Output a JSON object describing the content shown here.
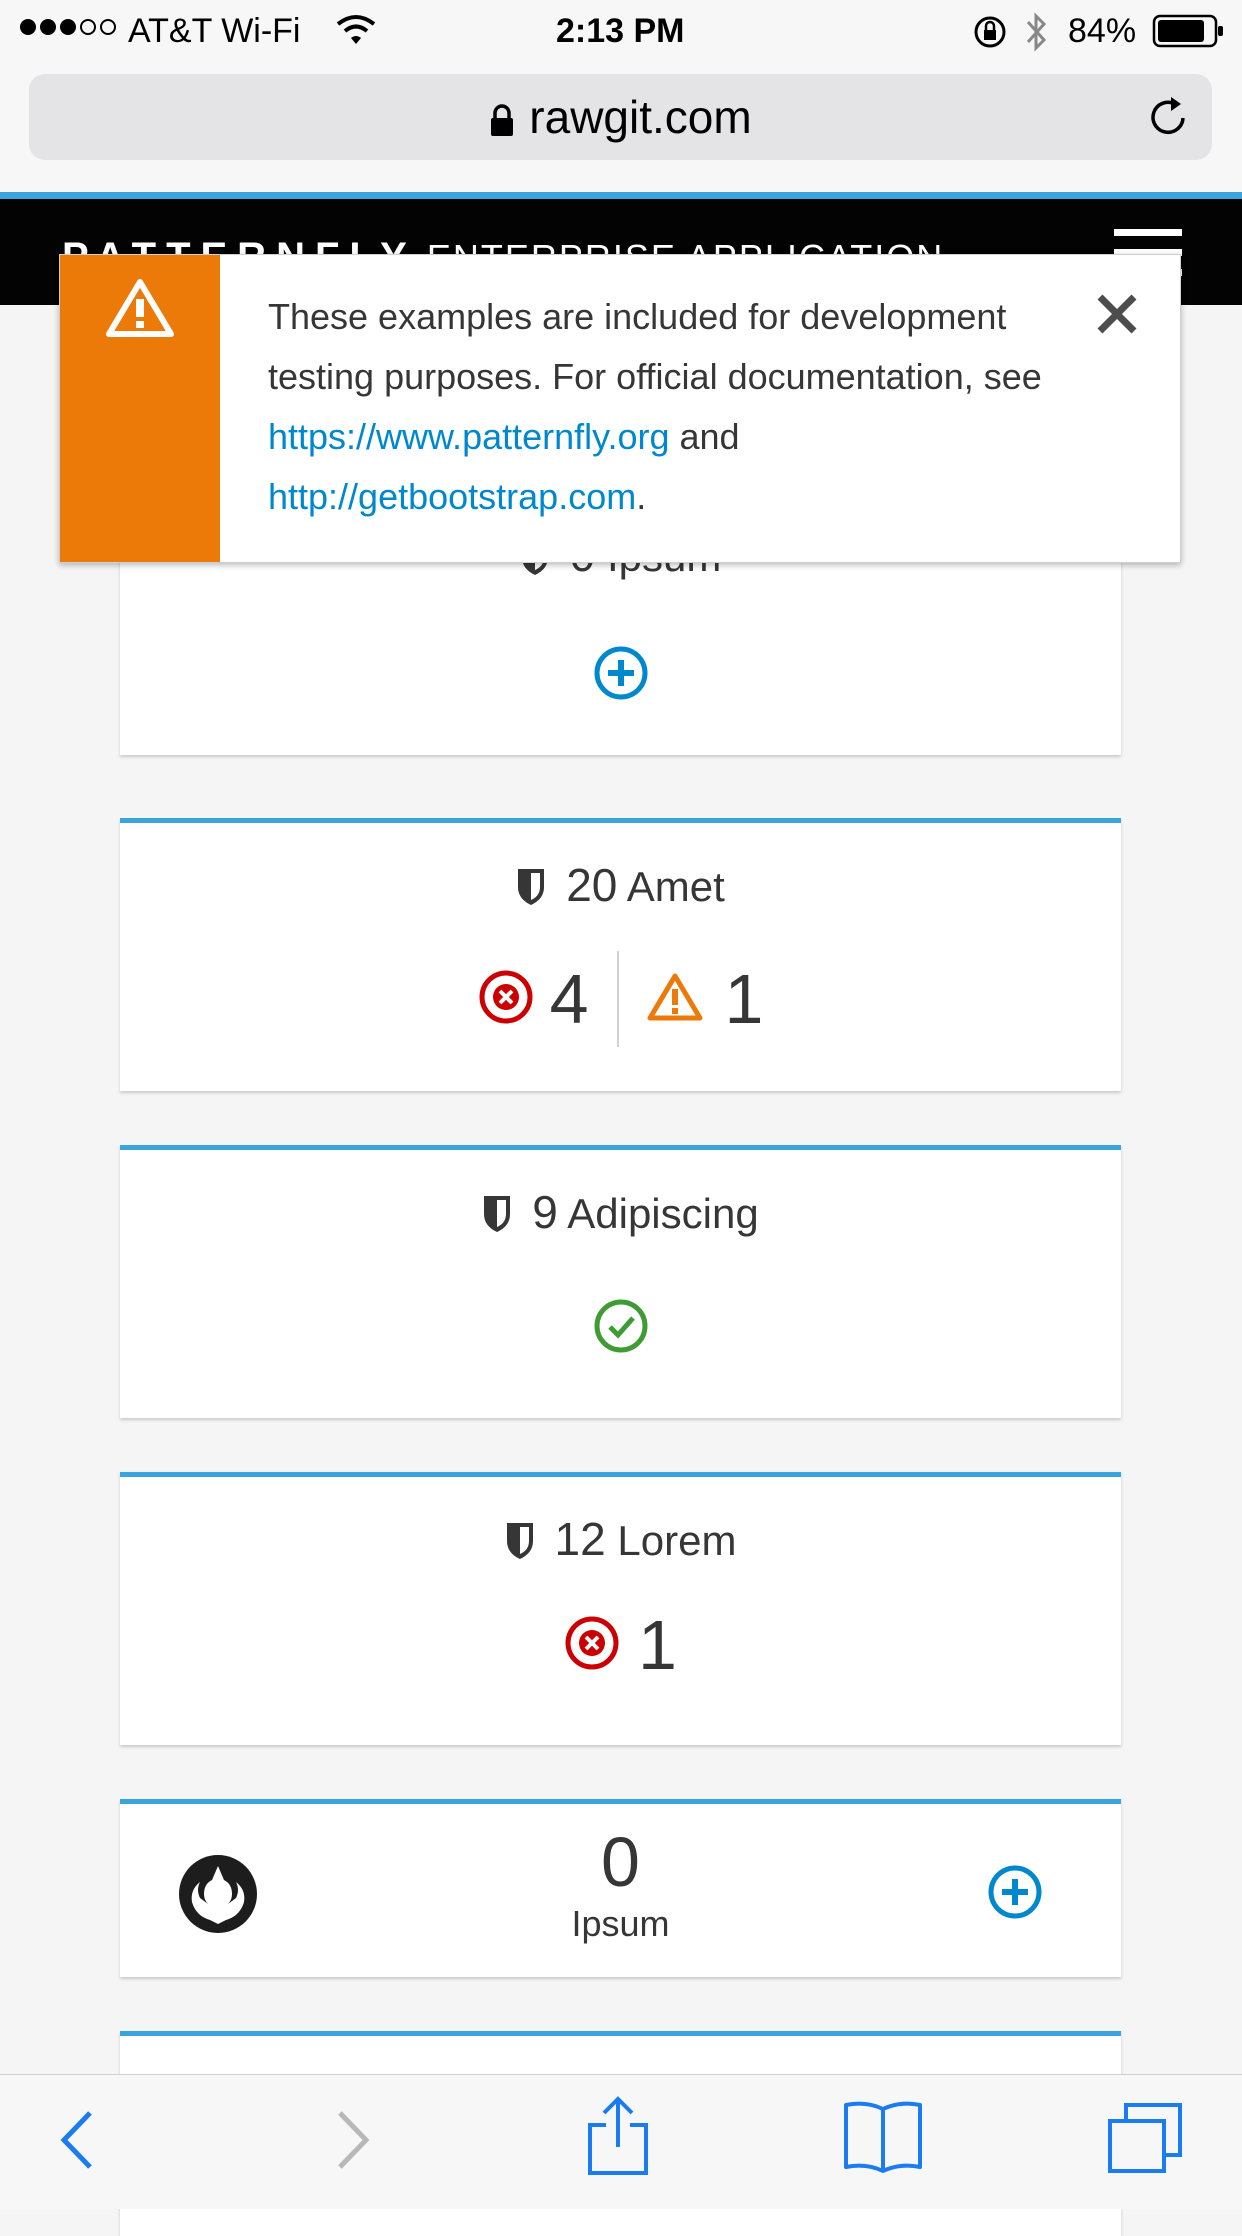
{
  "status_bar": {
    "carrier": "AT&T Wi-Fi",
    "time": "2:13 PM",
    "battery": "84%",
    "battery_level": 0.84
  },
  "browser": {
    "url": "rawgit.com"
  },
  "navbar": {
    "brand": "PATTERNFLY",
    "brand_sub": "ENTERPRISE APPLICATION"
  },
  "alert": {
    "text_1": "These examples are included for development testing purposes. For official documentation, see ",
    "link_1": "https://www.patternfly.org",
    "text_2": " and ",
    "link_2": "http://getbootstrap.com",
    "text_3": "."
  },
  "cards": {
    "c0": {
      "label": "Ipsum"
    },
    "c1": {
      "count": "20",
      "label": "Amet",
      "errors": "4",
      "warnings": "1"
    },
    "c2": {
      "count": "9",
      "label": "Adipiscing"
    },
    "c3": {
      "count": "12",
      "label": "Lorem",
      "errors": "1"
    },
    "c4": {
      "count": "0",
      "label": "Ipsum"
    }
  },
  "colors": {
    "accent": "#39a5dc",
    "link": "#0088ce",
    "warning": "#ec7a08",
    "error": "#cc0000",
    "success": "#3f9c35"
  }
}
